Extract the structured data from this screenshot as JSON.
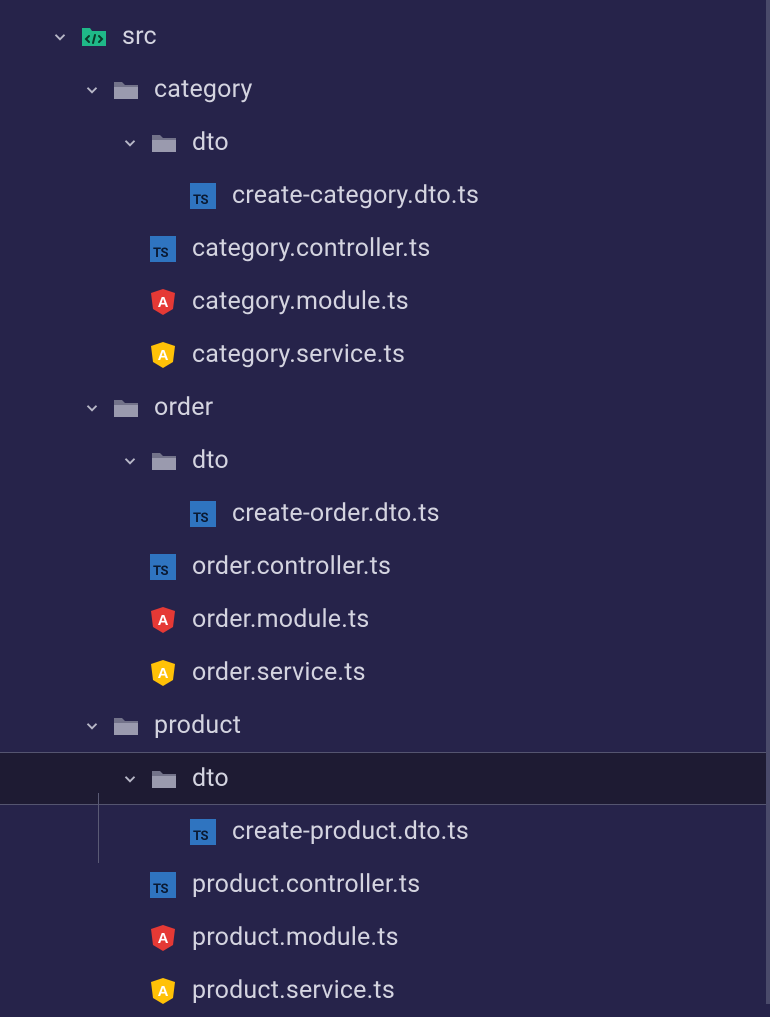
{
  "tree": [
    {
      "id": "src",
      "depth": 0,
      "type": "src-folder",
      "expanded": true,
      "label": "src",
      "selected": false
    },
    {
      "id": "category",
      "depth": 1,
      "type": "folder",
      "expanded": true,
      "label": "category",
      "selected": false
    },
    {
      "id": "category-dto",
      "depth": 2,
      "type": "folder",
      "expanded": true,
      "label": "dto",
      "selected": false
    },
    {
      "id": "create-category-dto",
      "depth": 3,
      "type": "ts",
      "label": "create-category.dto.ts",
      "selected": false
    },
    {
      "id": "category-controller",
      "depth": 2,
      "type": "ts",
      "label": "category.controller.ts",
      "selected": false
    },
    {
      "id": "category-module",
      "depth": 2,
      "type": "module",
      "label": "category.module.ts",
      "selected": false
    },
    {
      "id": "category-service",
      "depth": 2,
      "type": "service",
      "label": "category.service.ts",
      "selected": false
    },
    {
      "id": "order",
      "depth": 1,
      "type": "folder",
      "expanded": true,
      "label": "order",
      "selected": false
    },
    {
      "id": "order-dto",
      "depth": 2,
      "type": "folder",
      "expanded": true,
      "label": "dto",
      "selected": false
    },
    {
      "id": "create-order-dto",
      "depth": 3,
      "type": "ts",
      "label": "create-order.dto.ts",
      "selected": false
    },
    {
      "id": "order-controller",
      "depth": 2,
      "type": "ts",
      "label": "order.controller.ts",
      "selected": false
    },
    {
      "id": "order-module",
      "depth": 2,
      "type": "module",
      "label": "order.module.ts",
      "selected": false
    },
    {
      "id": "order-service",
      "depth": 2,
      "type": "service",
      "label": "order.service.ts",
      "selected": false
    },
    {
      "id": "product",
      "depth": 1,
      "type": "folder",
      "expanded": true,
      "label": "product",
      "selected": false
    },
    {
      "id": "product-dto",
      "depth": 2,
      "type": "folder",
      "expanded": true,
      "label": "dto",
      "selected": true
    },
    {
      "id": "create-product-dto",
      "depth": 3,
      "type": "ts",
      "label": "create-product.dto.ts",
      "selected": false
    },
    {
      "id": "product-controller",
      "depth": 2,
      "type": "ts",
      "label": "product.controller.ts",
      "selected": false
    },
    {
      "id": "product-module",
      "depth": 2,
      "type": "module",
      "label": "product.module.ts",
      "selected": false
    },
    {
      "id": "product-service",
      "depth": 2,
      "type": "service",
      "label": "product.service.ts",
      "selected": false
    }
  ],
  "colors": {
    "background": "#26234a",
    "text": "#d4d4e0",
    "folder": "#9a9aae",
    "srcFolder": "#1fb888",
    "tsBlue": "#2f74c0",
    "moduleRed": "#e53935",
    "serviceYellow": "#ffc107",
    "selectedBg": "#1e1b33"
  }
}
